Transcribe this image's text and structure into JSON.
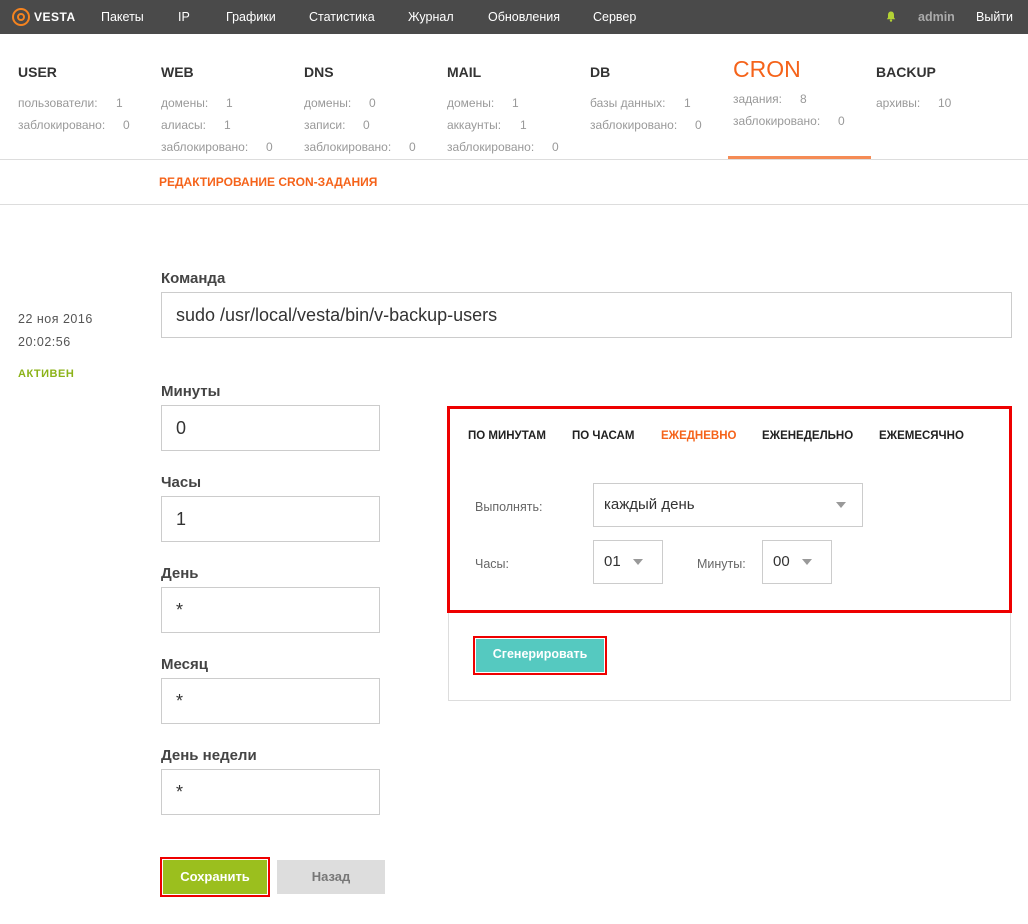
{
  "topnav": {
    "logo_text": "VESTA",
    "items": [
      "Пакеты",
      "IP",
      "Графики",
      "Статистика",
      "Журнал",
      "Обновления",
      "Сервер"
    ],
    "user": "admin",
    "logout": "Выйти"
  },
  "tabs": [
    {
      "title": "USER",
      "stats": [
        {
          "label": "пользователи:",
          "value": "1"
        },
        {
          "label": "заблокировано:",
          "value": "0"
        }
      ]
    },
    {
      "title": "WEB",
      "stats": [
        {
          "label": "домены:",
          "value": "1"
        },
        {
          "label": "алиасы:",
          "value": "1"
        },
        {
          "label": "заблокировано:",
          "value": "0"
        }
      ]
    },
    {
      "title": "DNS",
      "stats": [
        {
          "label": "домены:",
          "value": "0"
        },
        {
          "label": "записи:",
          "value": "0"
        },
        {
          "label": "заблокировано:",
          "value": "0"
        }
      ]
    },
    {
      "title": "MAIL",
      "stats": [
        {
          "label": "домены:",
          "value": "1"
        },
        {
          "label": "аккаунты:",
          "value": "1"
        },
        {
          "label": "заблокировано:",
          "value": "0"
        }
      ]
    },
    {
      "title": "DB",
      "stats": [
        {
          "label": "базы данных:",
          "value": "1"
        },
        {
          "label": "заблокировано:",
          "value": "0"
        }
      ]
    },
    {
      "title": "CRON",
      "stats": [
        {
          "label": "задания:",
          "value": "8"
        },
        {
          "label": "заблокировано:",
          "value": "0"
        }
      ]
    },
    {
      "title": "BACKUP",
      "stats": [
        {
          "label": "архивы:",
          "value": "10"
        }
      ]
    }
  ],
  "page": {
    "subtitle": "РЕДАКТИРОВАНИЕ CRON-ЗАДАНИЯ",
    "date": "22 ноя 2016",
    "time": "20:02:56",
    "status": "АКТИВЕН"
  },
  "form": {
    "command_label": "Команда",
    "command_value": "sudo /usr/local/vesta/bin/v-backup-users",
    "minutes_label": "Минуты",
    "minutes_value": "0",
    "hours_label": "Часы",
    "hours_value": "1",
    "day_label": "День",
    "day_value": "*",
    "month_label": "Месяц",
    "month_value": "*",
    "weekday_label": "День недели",
    "weekday_value": "*",
    "save": "Сохранить",
    "back": "Назад"
  },
  "generator": {
    "tabs": [
      "ПО МИНУТАМ",
      "ПО ЧАСАМ",
      "ЕЖЕДНЕВНО",
      "ЕЖЕНЕДЕЛЬНО",
      "ЕЖЕМЕСЯЧНО"
    ],
    "active_tab": "ЕЖЕДНЕВНО",
    "run_label": "Выполнять:",
    "run_value": "каждый день",
    "hours_label": "Часы:",
    "hours_value": "01",
    "minutes_label": "Минуты:",
    "minutes_value": "00",
    "generate": "Сгенерировать"
  },
  "colors": {
    "accent": "#f5631a",
    "active_green": "#8cb319",
    "save_green": "#9bbf1e",
    "generate_teal": "#55c9c0",
    "highlight_red": "#ee0000"
  }
}
